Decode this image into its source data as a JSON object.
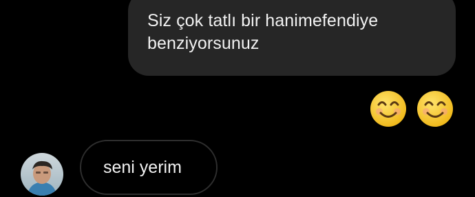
{
  "messages": {
    "outgoing_text": "Siz çok tatlı bir hanimefendiye benziyorsunuz",
    "emoji_reaction": [
      "smiling-face-with-smiling-eyes",
      "smiling-face-with-smiling-eyes"
    ],
    "incoming_text": "seni yerim"
  },
  "colors": {
    "background": "#000000",
    "outgoing_bubble": "#262626",
    "incoming_border": "#2e2e2e",
    "text": "#f2f2f2",
    "emoji_yellow": "#f7c629"
  }
}
